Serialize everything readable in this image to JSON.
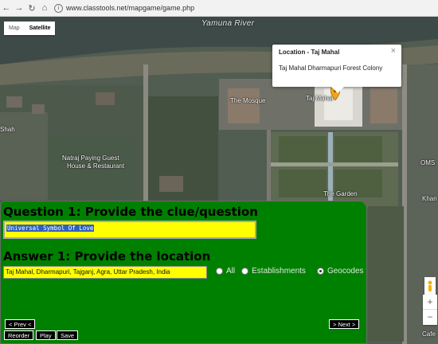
{
  "browser": {
    "url": "www.classtools.net/mapgame/game.php",
    "back_icon": "arrow-left",
    "forward_icon": "arrow-right",
    "reload_icon": "reload",
    "home_icon": "home"
  },
  "map": {
    "map_type": {
      "map_label": "Map",
      "satellite_label": "Satellite",
      "selected": "Satellite"
    },
    "labels": {
      "river": "Yamuna River",
      "mosque": "The Mosque",
      "taj": "Taj Mahal",
      "garden": "The Garden",
      "shah": "Shah",
      "natraj_line1": "Natraj Paying Guest",
      "natraj_line2": "House & Restaurant",
      "oms": "OMS",
      "khan": "Khan",
      "cafe": "Cafe"
    },
    "popup": {
      "title": "Location - Taj Mahal",
      "body": "Taj Mahal Dharmapuri Forest Colony",
      "close": "×"
    },
    "zoom_in": "+",
    "zoom_out": "−"
  },
  "game": {
    "question_heading": "Question 1: Provide the clue/question",
    "clue_value": "Universal Symbol Of Love",
    "answer_heading": "Answer 1: Provide the location",
    "answer_value": "Taj Mahal, Dharmapuri, Tajganj, Agra, Uttar Pradesh, India",
    "search_modes": [
      {
        "label": "All",
        "checked": false
      },
      {
        "label": "Establishments",
        "checked": false
      },
      {
        "label": "Geocodes",
        "checked": true
      }
    ],
    "buttons": {
      "prev": "< Prev <",
      "next": "> Next >",
      "reorder": "Reorder",
      "play": "Play",
      "save": "Save"
    }
  },
  "colors": {
    "panel": "#008000",
    "input": "#ffff00",
    "selection": "#2f5fbf"
  }
}
